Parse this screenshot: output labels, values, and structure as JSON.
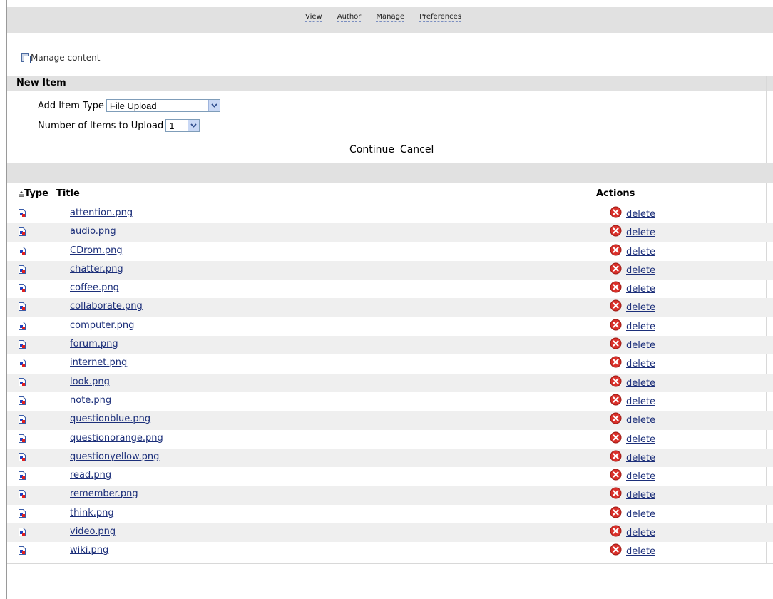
{
  "nav": {
    "items": [
      "View",
      "Author",
      "Manage",
      "Preferences"
    ]
  },
  "manage_content": {
    "label": "Manage content",
    "icon": "content-manager-icon"
  },
  "new_item": {
    "header": "New Item",
    "add_item_type_label": "Add Item Type",
    "add_item_type_value": "File Upload",
    "number_label": "Number of Items to Upload",
    "number_value": "1",
    "continue_label": "Continue",
    "cancel_label": "Cancel"
  },
  "table": {
    "columns": {
      "type": "Type",
      "title": "Title",
      "actions": "Actions"
    },
    "sort_icon": "sort-ascending-icon",
    "delete_label": "delete",
    "rows": [
      {
        "title": "attention.png"
      },
      {
        "title": "audio.png"
      },
      {
        "title": "CDrom.png"
      },
      {
        "title": "chatter.png"
      },
      {
        "title": "coffee.png"
      },
      {
        "title": "collaborate.png"
      },
      {
        "title": "computer.png"
      },
      {
        "title": "forum.png"
      },
      {
        "title": "internet.png"
      },
      {
        "title": "look.png"
      },
      {
        "title": "note.png"
      },
      {
        "title": "questionblue.png"
      },
      {
        "title": "questionorange.png"
      },
      {
        "title": "questionyellow.png"
      },
      {
        "title": "read.png"
      },
      {
        "title": "remember.png"
      },
      {
        "title": "think.png"
      },
      {
        "title": "video.png"
      },
      {
        "title": "wiki.png"
      }
    ]
  },
  "colors": {
    "header_bg": "#e1e1e1",
    "alt_row_bg": "#efefef",
    "link": "#1c2f7a",
    "delete_icon": "#d9302a"
  }
}
